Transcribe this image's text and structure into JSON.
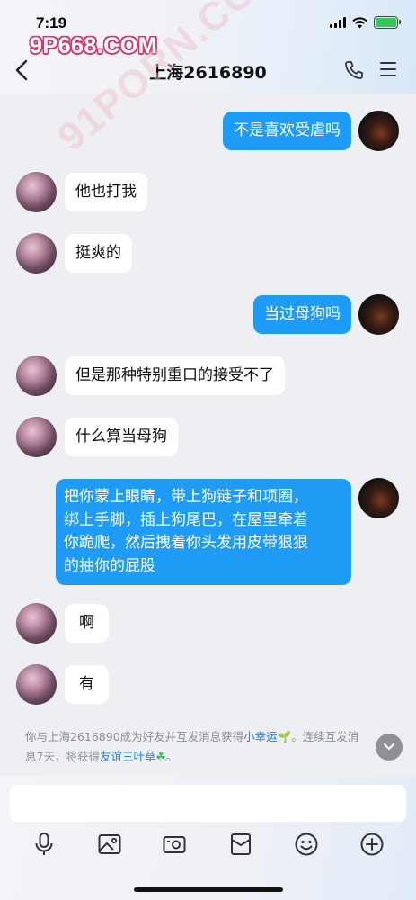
{
  "status": {
    "time": "7:19"
  },
  "watermark": {
    "top": "9P668.COM",
    "diagonal": "91PORN.COM"
  },
  "header": {
    "title": "上海2616890"
  },
  "messages": [
    {
      "side": "right",
      "text": "不是喜欢受虐吗"
    },
    {
      "side": "left",
      "text": "他也打我"
    },
    {
      "side": "left",
      "text": "挺爽的"
    },
    {
      "side": "right",
      "text": "当过母狗吗"
    },
    {
      "side": "left",
      "text": "但是那种特别重口的接受不了"
    },
    {
      "side": "left",
      "text": "什么算当母狗"
    },
    {
      "side": "right",
      "lines": [
        "把你蒙上眼睛，带上狗链子和项圈，",
        "绑上手脚，插上狗尾巴，在屋里牵着",
        "你跪爬，然后拽着你头发用皮带狠狠",
        "的抽你的屁股"
      ]
    },
    {
      "side": "left",
      "text": "啊"
    },
    {
      "side": "left",
      "text": "有"
    }
  ],
  "system_note": {
    "part1": "你与上海2616890成为好友并互发消息获得",
    "link1": "小幸运",
    "part2": "。连续互发消",
    "part3": "息7天，将获得",
    "link2": "友谊三叶草",
    "part4": "。"
  },
  "input": {
    "placeholder": ""
  },
  "toolbar": [
    "microphone-icon",
    "image-icon",
    "camera-icon",
    "red-packet-icon",
    "emoji-icon",
    "plus-icon"
  ],
  "colors": {
    "bubble_right": "#1e9bf5",
    "bubble_left": "#ffffff",
    "background": "#eeeff3",
    "link": "#2a7fd4"
  }
}
